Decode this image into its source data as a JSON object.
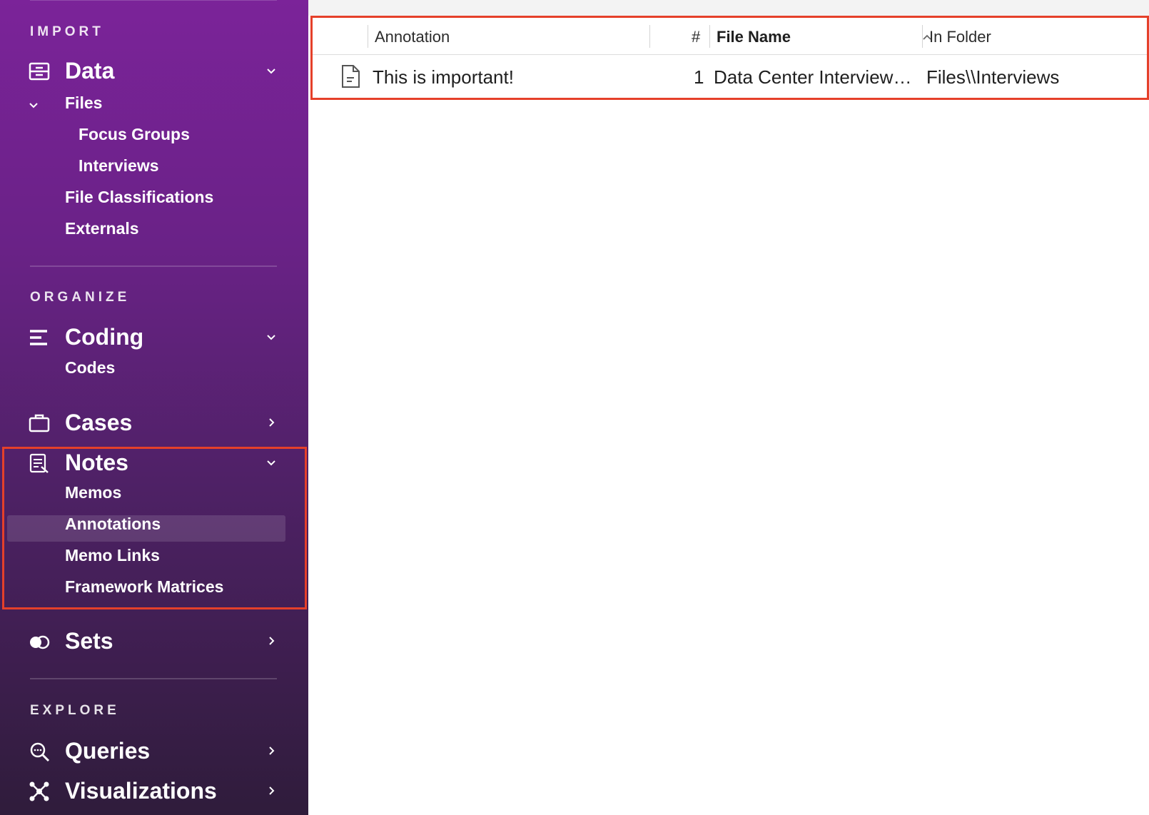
{
  "sidebar": {
    "sections": {
      "import": "IMPORT",
      "organize": "ORGANIZE",
      "explore": "EXPLORE"
    },
    "groups": {
      "data": "Data",
      "coding": "Coding",
      "cases": "Cases",
      "notes": "Notes",
      "sets": "Sets",
      "queries": "Queries",
      "visualizations": "Visualizations"
    },
    "items": {
      "files": "Files",
      "focus_groups": "Focus Groups",
      "interviews": "Interviews",
      "file_classifications": "File Classifications",
      "externals": "Externals",
      "codes": "Codes",
      "memos": "Memos",
      "annotations": "Annotations",
      "memo_links": "Memo Links",
      "framework_matrices": "Framework Matrices"
    },
    "selected_item": "Annotations"
  },
  "table": {
    "columns": {
      "annotation": "Annotation",
      "number": "#",
      "file_name": "File Name",
      "in_folder": "In Folder"
    },
    "sorted_column": "File Name",
    "rows": [
      {
        "icon": "document-icon",
        "annotation": "This is important!",
        "number": "1",
        "file_name": "Data Center Interview…",
        "in_folder": "Files\\\\Interviews"
      }
    ]
  },
  "colors": {
    "sidebar_top": "#7b2399",
    "sidebar_bottom": "#2f1c3b",
    "highlight": "#e5402a"
  }
}
